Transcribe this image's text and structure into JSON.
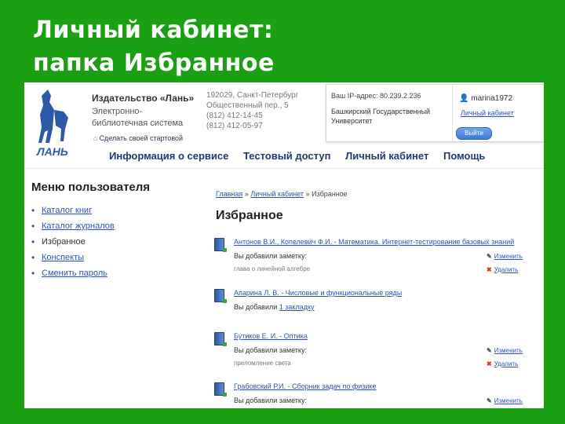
{
  "slide": {
    "title_line1": "Личный кабинет:",
    "title_line2": "папка Избранное"
  },
  "header": {
    "logo_text": "ЛАНЬ",
    "publisher_name": "Издательство «Лань»",
    "publisher_sub": "Электронно-библиотечная система",
    "home_link": "Сделать своей стартовой",
    "contacts": [
      "192029, Санкт-Петербург",
      "Общественный пер., 5",
      "(812) 412-14-45",
      "(812) 412-05-97"
    ],
    "ip_label": "Ваш IP-адрес: 80.239.2.236",
    "organization": "Башкирский Государственный Университет",
    "username": "marina1972",
    "cabinet_link": "Личный кабинет",
    "exit_label": "Выйти"
  },
  "nav": {
    "items": [
      "Информация о сервисе",
      "Тестовый доступ",
      "Личный кабинет",
      "Помощь"
    ]
  },
  "menu": {
    "title": "Меню пользователя",
    "items": [
      "Каталог книг",
      "Каталог журналов",
      "Избранное",
      "Конспекты",
      "Сменить пароль"
    ]
  },
  "main": {
    "breadcrumb_home": "Главная",
    "breadcrumb_cabinet": "Личный кабинет",
    "breadcrumb_current": "Избранное",
    "breadcrumb_sep": "»",
    "title": "Избранное",
    "edit_label": "Изменить",
    "delete_label": "Удалить",
    "entries": [
      {
        "title": "Антонов В.И., Копелевич Ф.И. - Математика. Интернет-тестирование базовых знаний",
        "note_label": "Вы добавили заметку:",
        "note_text": "глава о линейной алгебре"
      },
      {
        "title": "Апарина Л. В. - Числовые и функциональные ряды",
        "note_label": "Вы добавили",
        "bookmark_link": "1 закладку"
      },
      {
        "title": "Бутиков Е. И. - Оптика",
        "note_label": "Вы добавили заметку:",
        "note_text": "преломление света"
      },
      {
        "title": "Грабовский Р.И. - Сборник задач по физике",
        "note_label": "Вы добавили заметку:"
      }
    ]
  }
}
